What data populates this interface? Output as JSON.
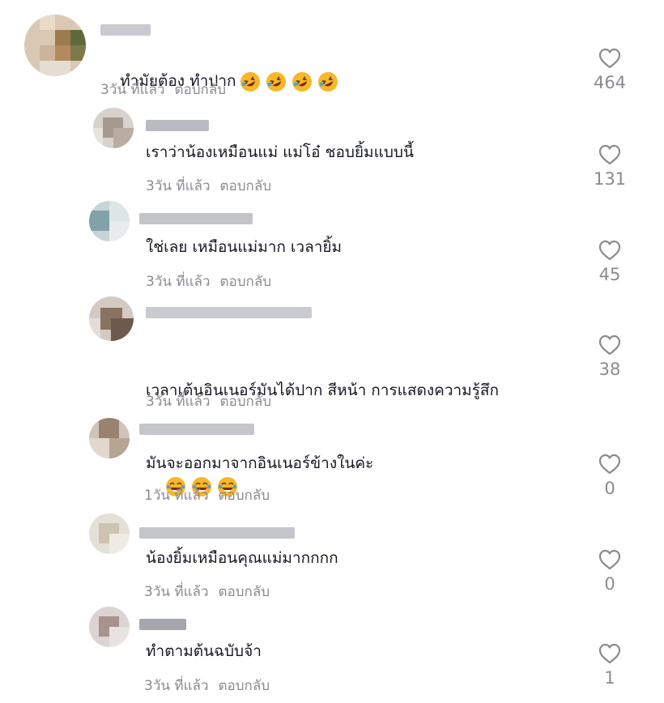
{
  "comments": [
    {
      "text": "ทำมัยต้อง ทำปาก",
      "emoji": [
        "rolling-laughing-emoji",
        "rolling-laughing-emoji",
        "rolling-laughing-emoji",
        "rolling-laughing-emoji"
      ],
      "time": "3วัน ที่แล้ว",
      "reply_label": "ตอบกลับ",
      "likes": "464",
      "level": "top"
    },
    {
      "text": "เราว่าน้องเหมือนแม่ แม่โอ๋ ชอบยิ้มแบบนี้",
      "time": "3วัน ที่แล้ว",
      "reply_label": "ตอบกลับ",
      "likes": "131",
      "level": "reply"
    },
    {
      "text": "ใช่เลย เหมือนแม่มาก เวลายิ้ม",
      "time": "3วัน ที่แล้ว",
      "reply_label": "ตอบกลับ",
      "likes": "45",
      "level": "reply"
    },
    {
      "text_line1": "เวลาเต้นอินเนอร์มันได้ปาก สีหน้า การแสดงความรู้สึก",
      "text_line2": "มันจะออกมาจากอินเนอร์ข้างในค่ะ",
      "time": "3วัน ที่แล้ว",
      "reply_label": "ตอบกลับ",
      "likes": "38",
      "level": "reply"
    },
    {
      "emoji": [
        "tears-of-joy-emoji",
        "tears-of-joy-emoji",
        "tears-of-joy-emoji"
      ],
      "time": "1วัน ที่แล้ว",
      "reply_label": "ตอบกลับ",
      "likes": "0",
      "level": "reply"
    },
    {
      "text": "น้องยิ้มเหมือนคุณแม่มากกกก",
      "time": "3วัน ที่แล้ว",
      "reply_label": "ตอบกลับ",
      "likes": "0",
      "level": "reply"
    },
    {
      "text": "ทำตามต้นฉบับจ้า",
      "time": "3วัน ที่แล้ว",
      "reply_label": "ตอบกลับ",
      "likes": "1",
      "level": "reply"
    }
  ],
  "colors": {
    "text": "#161823",
    "muted": "#8a8b91",
    "blur": "#c9cbd1"
  }
}
